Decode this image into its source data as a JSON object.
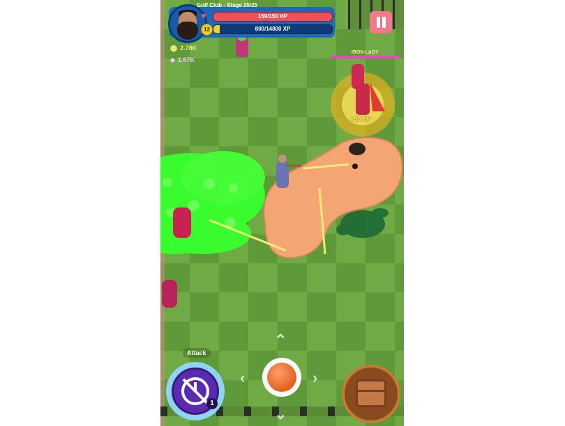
{
  "hud": {
    "location_stage": "Golf Club - Stage 25/25",
    "hp_text": "159/159 HP",
    "level": "12",
    "xp_text": "800/14800 XP",
    "xp_progress": 0.054
  },
  "resources": {
    "gold": "2.78K",
    "gems": "1.57K"
  },
  "boss": {
    "name": "IRON LADY"
  },
  "popup": {
    "xp_gain": "+50 XP"
  },
  "controls": {
    "attack_label": "Attack",
    "attack_charges": "1"
  },
  "colors": {
    "hp": "#f0505a",
    "xp_fill": "#f3cf29",
    "hud_blue": "#1f67b8",
    "pause": "#f07a8a",
    "toxic_green": "#38ff2e",
    "boss_bar": "#e548c0"
  },
  "icons": [
    "heart-icon",
    "level-badge-icon",
    "gold-coin-icon",
    "gem-icon",
    "pause-icon",
    "skull-icon",
    "chest-icon",
    "attack-skill-icon"
  ]
}
